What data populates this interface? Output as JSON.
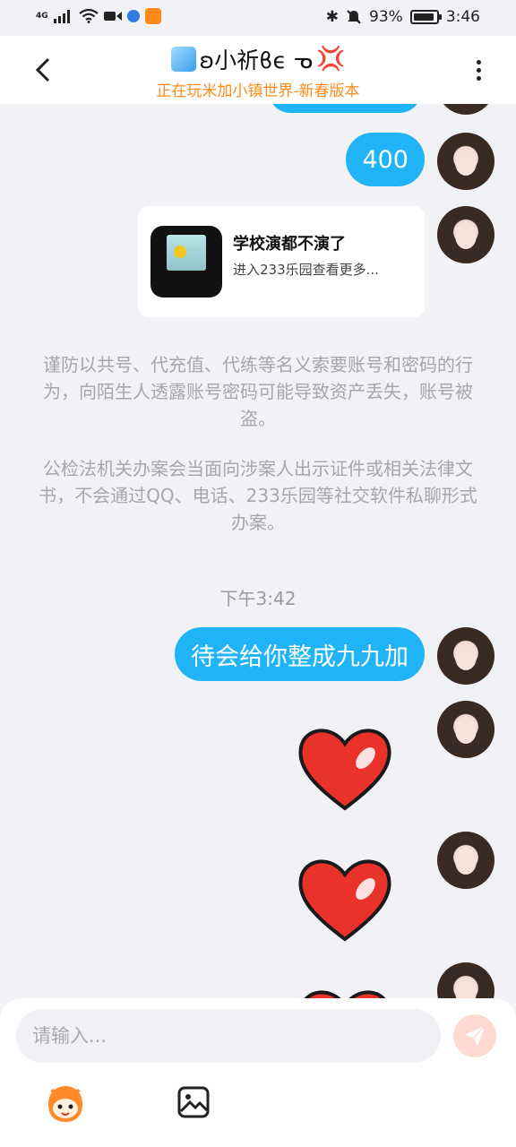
{
  "status_bar": {
    "network": "4G",
    "battery": "93%",
    "battery_level": 0.93,
    "time": "3:46"
  },
  "header": {
    "title": "ʚ小祈ϐϵ ᓀ",
    "subtitle": "正在玩米加小镇世界-新春版本"
  },
  "messages": {
    "m1_text": "400",
    "card": {
      "title": "学校演都不演了",
      "subtitle": "进入233乐园查看更多..."
    },
    "notice1": "谨防以共号、代充值、代练等名义索要账号和密码的行为，向陌生人透露账号密码可能导致资产丢失，账号被盗。",
    "notice2": "公检法机关办案会当面向涉案人出示证件或相关法律文书，不会通过QQ、电话、233乐园等社交软件私聊形式办案。",
    "time_label": "下午3:42",
    "m2_text": "待会给你整成九九加"
  },
  "input": {
    "placeholder": "请输入..."
  },
  "colors": {
    "bubble": "#20b3f5",
    "subtitle": "#ff8a1a",
    "send": "#ffd9d2"
  }
}
